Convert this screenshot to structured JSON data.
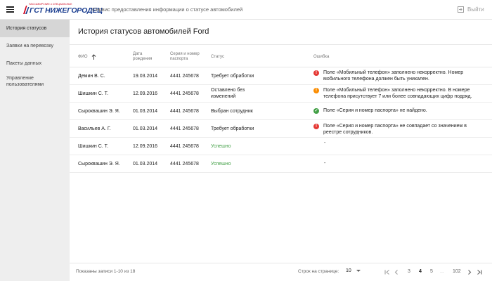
{
  "header": {
    "logo_subtitle": "ПАССАЖИРСКИЕ и СПЕЦИАЛЬНЫЕ",
    "logo_text": "ГСТ НИЖЕГОРОДЕЦ",
    "app_title": "Сервис предоставления информации о статусе автомобилей",
    "logout_label": "Выйти"
  },
  "sidebar": {
    "items": [
      {
        "label": "История статусов",
        "active": true
      },
      {
        "label": "Заявки на перевозку",
        "active": false
      },
      {
        "label": "Пакеты данных",
        "active": false
      },
      {
        "label": "Управление пользователями",
        "active": false
      }
    ]
  },
  "main": {
    "title": "История статусов автомобилей Ford",
    "columns": {
      "name": "ФИО",
      "dob": "Дата рождения",
      "passport": "Серия и номер паспорта",
      "status": "Статус",
      "error": "Ошибка"
    },
    "rows": [
      {
        "name": "Демин В. С.",
        "dob": "19.03.2014",
        "passport": "4441 245678",
        "status": "Требует обработки",
        "error": "Поле «Мобильный телефон» заполнено некорректно. Номер мобильного телефона должен быть уникален.",
        "error_level": "red"
      },
      {
        "name": "Шишкин С. Т.",
        "dob": "12.09.2016",
        "passport": "4441 245678",
        "status": "Оставлено без изменений",
        "error": "Поле «Мобильный телефон» заполнено некорректно. В номере телефона присутствует 7 или более совпадающих цифр подряд.",
        "error_level": "orange"
      },
      {
        "name": "Сыроквашин Э. Я.",
        "dob": "01.03.2014",
        "passport": "4441 245678",
        "status": "Выбран сотрудник",
        "error": "Поле «Серия и номер паспорта» не найдено.",
        "error_level": "green"
      },
      {
        "name": "Васильев А. Г.",
        "dob": "01.03.2014",
        "passport": "4441 245678",
        "status": "Требует обработки",
        "error": "Поле «Серия и номер паспорта» не совпадает со значением в реестре сотрудников.",
        "error_level": "red"
      },
      {
        "name": "Шишкин С. Т.",
        "dob": "12.09.2016",
        "passport": "4441 245678",
        "status": "Успешно",
        "error": "-",
        "error_level": "none"
      },
      {
        "name": "Сыроквашин Э. Я.",
        "dob": "01.03.2014",
        "passport": "4441 245678",
        "status": "Успешно",
        "error": "-",
        "error_level": "none"
      }
    ]
  },
  "footer": {
    "records_text": "Показаны записи 1-10 из 18",
    "rows_per_page_label": "Строк на странице:",
    "rows_per_page_value": "10",
    "pages": [
      "3",
      "4",
      "5",
      "...",
      "102"
    ],
    "current_page": "4"
  },
  "colors": {
    "success": "#43a047",
    "error": "#e53935",
    "warning": "#fb8c00",
    "brand_blue": "#1a3d8f",
    "brand_red": "#d0021b"
  }
}
